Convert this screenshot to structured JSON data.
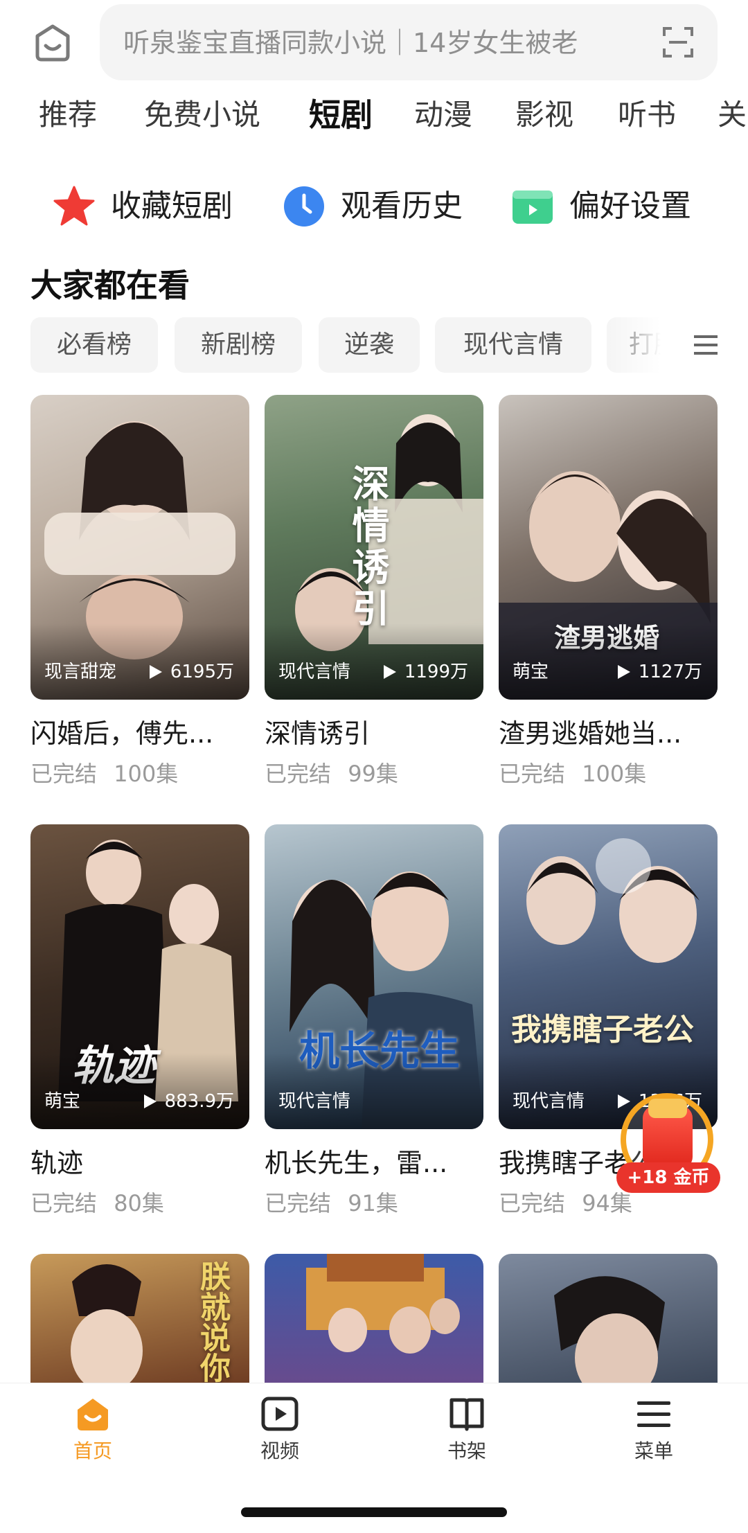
{
  "search": {
    "text": "听泉鉴宝直播同款小说｜14岁女生被老"
  },
  "tabs": [
    {
      "label": "推荐"
    },
    {
      "label": "免费小说"
    },
    {
      "label": "短剧",
      "active": true
    },
    {
      "label": "动漫"
    },
    {
      "label": "影视"
    },
    {
      "label": "听书"
    },
    {
      "label": "关"
    }
  ],
  "quick": {
    "favorites": "收藏短剧",
    "history": "观看历史",
    "preferences": "偏好设置"
  },
  "section_title": "大家都在看",
  "chips": [
    "必看榜",
    "新剧榜",
    "逆袭",
    "现代言情",
    "打脸"
  ],
  "cards": [
    {
      "genre": "现言甜宠",
      "plays": "6195万",
      "title": "闪婚后，傅先...",
      "status": "已完结",
      "episodes": "100集",
      "poster_text": ""
    },
    {
      "genre": "现代言情",
      "plays": "1199万",
      "title": "深情诱引",
      "status": "已完结",
      "episodes": "99集",
      "poster_text": "深情诱引"
    },
    {
      "genre": "萌宝",
      "plays": "1127万",
      "title": "渣男逃婚她当...",
      "status": "已完结",
      "episodes": "100集",
      "poster_text": "渣男逃婚"
    },
    {
      "genre": "萌宝",
      "plays": "883.9万",
      "title": "轨迹",
      "status": "已完结",
      "episodes": "80集",
      "poster_text": "轨迹"
    },
    {
      "genre": "现代言情",
      "plays": "",
      "title": "机长先生，雷...",
      "status": "已完结",
      "episodes": "91集",
      "poster_text": "机长先生"
    },
    {
      "genre": "现代言情",
      "plays": "1386万",
      "title": "我携瞎子老公...",
      "status": "已完结",
      "episodes": "94集",
      "poster_text": "我携瞎子老公"
    },
    {
      "genre": "",
      "plays": "",
      "title": "",
      "status": "",
      "episodes": "",
      "poster_text": "朕就说你们"
    },
    {
      "genre": "",
      "plays": "",
      "title": "",
      "status": "",
      "episodes": "",
      "poster_text": ""
    },
    {
      "genre": "",
      "plays": "",
      "title": "",
      "status": "",
      "episodes": "",
      "poster_text": ""
    }
  ],
  "coin_badge": "+18 金币",
  "nav": {
    "home": "首页",
    "video": "视频",
    "bookshelf": "书架",
    "menu": "菜单"
  },
  "colors": {
    "accent": "#f59a23",
    "chip_bg": "#f4f4f4",
    "coin_red": "#e9342c"
  }
}
